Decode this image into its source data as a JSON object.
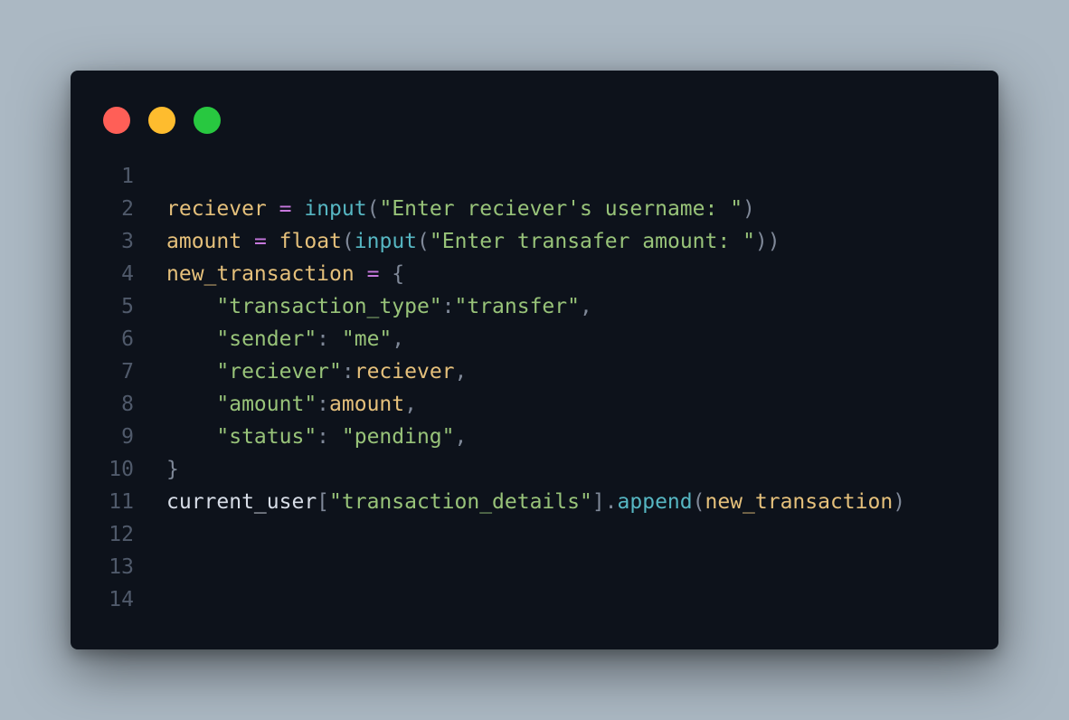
{
  "window": {
    "controls": [
      {
        "name": "close",
        "color": "#ff5f57"
      },
      {
        "name": "minimize",
        "color": "#febc2e"
      },
      {
        "name": "maximize",
        "color": "#28c840"
      }
    ]
  },
  "code": {
    "lines": [
      {
        "number": "1",
        "tokens": []
      },
      {
        "number": "2",
        "tokens": [
          {
            "t": "reciever",
            "k": "var"
          },
          {
            "t": " ",
            "k": "plain"
          },
          {
            "t": "=",
            "k": "op"
          },
          {
            "t": " ",
            "k": "plain"
          },
          {
            "t": "input",
            "k": "fn"
          },
          {
            "t": "(",
            "k": "punc"
          },
          {
            "t": "\"Enter reciever's username: \"",
            "k": "str"
          },
          {
            "t": ")",
            "k": "punc"
          }
        ]
      },
      {
        "number": "3",
        "tokens": [
          {
            "t": "amount",
            "k": "var"
          },
          {
            "t": " ",
            "k": "plain"
          },
          {
            "t": "=",
            "k": "op"
          },
          {
            "t": " ",
            "k": "plain"
          },
          {
            "t": "float",
            "k": "var"
          },
          {
            "t": "(",
            "k": "punc"
          },
          {
            "t": "input",
            "k": "fn"
          },
          {
            "t": "(",
            "k": "punc"
          },
          {
            "t": "\"Enter transafer amount: \"",
            "k": "str"
          },
          {
            "t": "))",
            "k": "punc"
          }
        ]
      },
      {
        "number": "4",
        "tokens": [
          {
            "t": "new_transaction",
            "k": "var"
          },
          {
            "t": " ",
            "k": "plain"
          },
          {
            "t": "=",
            "k": "op"
          },
          {
            "t": " ",
            "k": "plain"
          },
          {
            "t": "{",
            "k": "punc"
          }
        ]
      },
      {
        "number": "5",
        "tokens": [
          {
            "t": "    ",
            "k": "plain"
          },
          {
            "t": "\"transaction_type\"",
            "k": "str"
          },
          {
            "t": ":",
            "k": "punc"
          },
          {
            "t": "\"transfer\"",
            "k": "str"
          },
          {
            "t": ",",
            "k": "punc"
          }
        ]
      },
      {
        "number": "6",
        "tokens": [
          {
            "t": "    ",
            "k": "plain"
          },
          {
            "t": "\"sender\"",
            "k": "str"
          },
          {
            "t": ": ",
            "k": "punc"
          },
          {
            "t": "\"me\"",
            "k": "str"
          },
          {
            "t": ",",
            "k": "punc"
          }
        ]
      },
      {
        "number": "7",
        "tokens": [
          {
            "t": "    ",
            "k": "plain"
          },
          {
            "t": "\"reciever\"",
            "k": "str"
          },
          {
            "t": ":",
            "k": "punc"
          },
          {
            "t": "reciever",
            "k": "var"
          },
          {
            "t": ",",
            "k": "punc"
          }
        ]
      },
      {
        "number": "8",
        "tokens": [
          {
            "t": "    ",
            "k": "plain"
          },
          {
            "t": "\"amount\"",
            "k": "str"
          },
          {
            "t": ":",
            "k": "punc"
          },
          {
            "t": "amount",
            "k": "var"
          },
          {
            "t": ",",
            "k": "punc"
          }
        ]
      },
      {
        "number": "9",
        "tokens": [
          {
            "t": "    ",
            "k": "plain"
          },
          {
            "t": "\"status\"",
            "k": "str"
          },
          {
            "t": ": ",
            "k": "punc"
          },
          {
            "t": "\"pending\"",
            "k": "str"
          },
          {
            "t": ",",
            "k": "punc"
          }
        ]
      },
      {
        "number": "10",
        "tokens": [
          {
            "t": "}",
            "k": "punc"
          }
        ]
      },
      {
        "number": "11",
        "tokens": [
          {
            "t": "current_user",
            "k": "plain"
          },
          {
            "t": "[",
            "k": "punc"
          },
          {
            "t": "\"transaction_details\"",
            "k": "str"
          },
          {
            "t": "].",
            "k": "punc"
          },
          {
            "t": "append",
            "k": "fn"
          },
          {
            "t": "(",
            "k": "punc"
          },
          {
            "t": "new_transaction",
            "k": "var"
          },
          {
            "t": ")",
            "k": "punc"
          }
        ]
      },
      {
        "number": "12",
        "tokens": []
      },
      {
        "number": "13",
        "tokens": []
      },
      {
        "number": "14",
        "tokens": []
      }
    ]
  }
}
